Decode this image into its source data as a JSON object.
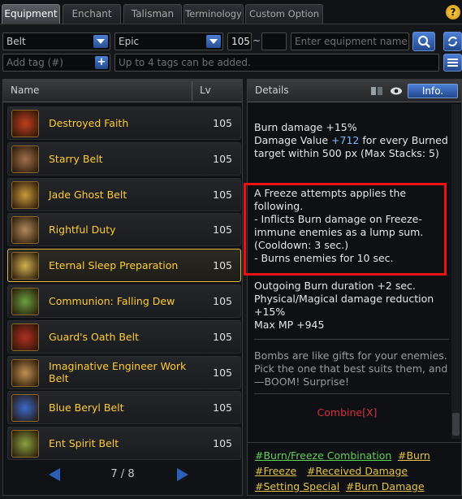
{
  "tabs": [
    "Equipment",
    "Enchant",
    "Talisman",
    "Terminology",
    "Custom Option"
  ],
  "active_tab": "Equipment",
  "filters": {
    "slot": "Belt",
    "rarity": "Epic",
    "level_min": "105",
    "level_sep": "~",
    "level_max": "",
    "search_placeholder": "Enter equipment name.",
    "tag_placeholder": "Add tag (#)",
    "tag_hint": "Up to 4 tags can be added."
  },
  "list": {
    "col_name": "Name",
    "col_lv": "Lv",
    "items": [
      {
        "name": "Destroyed Faith",
        "lv": "105"
      },
      {
        "name": "Starry Belt",
        "lv": "105"
      },
      {
        "name": "Jade Ghost Belt",
        "lv": "105"
      },
      {
        "name": "Rightful Duty",
        "lv": "105"
      },
      {
        "name": "Eternal Sleep Preparation",
        "lv": "105"
      },
      {
        "name": "Communion: Falling Dew",
        "lv": "105"
      },
      {
        "name": "Guard's Oath Belt",
        "lv": "105"
      },
      {
        "name": "Imaginative Engineer Work Belt",
        "lv": "105"
      },
      {
        "name": "Blue Beryl Belt",
        "lv": "105"
      },
      {
        "name": "Ent Spirit Belt",
        "lv": "105"
      }
    ],
    "selected_index": 4,
    "page": "7 / 8"
  },
  "details": {
    "title": "Details",
    "info_label": "Info.",
    "burn_damage": "Burn damage +15%",
    "damage_value_prefix": "Damage Value ",
    "damage_value_num": "+712",
    "damage_value_suffix": " for every Burned target within 500 px (Max Stacks: 5)",
    "freeze_block": "A Freeze attempts applies the following.\n- Inflicts Burn damage on Freeze-immune enemies as a lump sum. (Cooldown: 3 sec.)\n- Burns enemies for 10 sec.",
    "stats_block": "Outgoing Burn duration +2 sec.\nPhysical/Magical damage reduction +15%\nMax MP +945",
    "flavor": "Bombs are like gifts for your enemies. Pick the one that best suits them, and—BOOM! Surprise!",
    "combine": "Combine[X]"
  },
  "tags": [
    "#Burn/Freeze Combination",
    "#Burn",
    "#Freeze",
    "#Received Damage",
    "#Setting Special",
    "#Burn Damage"
  ],
  "colors": {
    "item_name": "#ffcc33",
    "highlight_box": "#ee1111",
    "tag_highlight": "#63d05a",
    "tag": "#e4c34a",
    "damage_value": "#7fb7ff",
    "combine": "#d8303a"
  }
}
